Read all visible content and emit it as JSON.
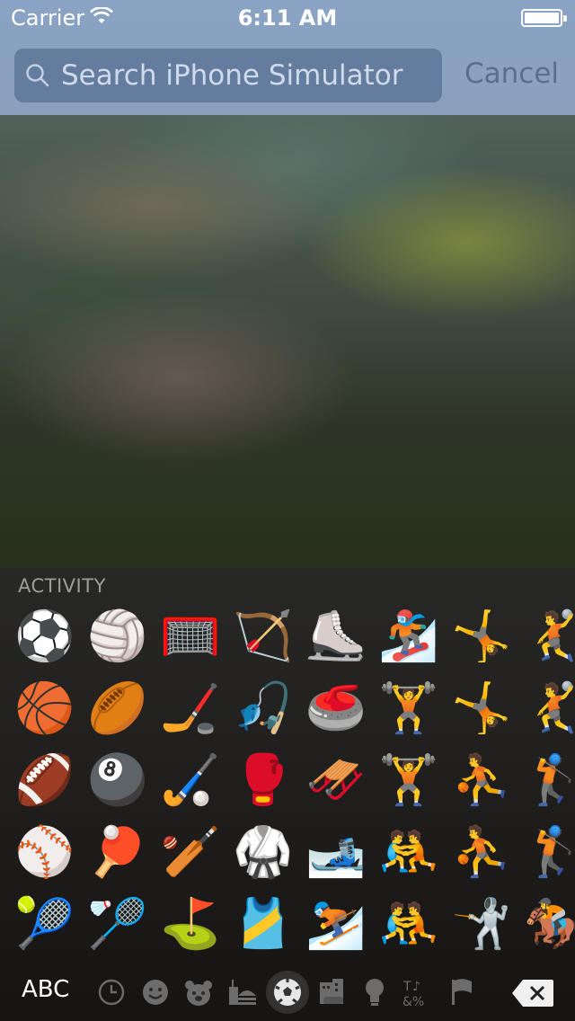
{
  "status": {
    "carrier": "Carrier",
    "time": "6:11 AM"
  },
  "search": {
    "placeholder": "Search iPhone Simulator",
    "cancel": "Cancel"
  },
  "keyboard": {
    "section": "ACTIVITY",
    "abc": "ABC",
    "emoji": [
      [
        "⚽",
        "🏐",
        "🥅",
        "🏹",
        "⛸️",
        "🏂",
        "🤸",
        "🤾"
      ],
      [
        "🏀",
        "🏉",
        "🏒",
        "🎣",
        "🥌",
        "🏋️",
        "🤸",
        "🤾"
      ],
      [
        "🏈",
        "🎱",
        "🏑",
        "🥊",
        "🛷",
        "🏋️",
        "⛹️",
        "🏌️"
      ],
      [
        "⚾",
        "🏓",
        "🏏",
        "🥋",
        "🎿",
        "🤼",
        "⛹️",
        "🏌️"
      ],
      [
        "🎾",
        "🏸",
        "⛳",
        "🎽",
        "⛷️",
        "🤼",
        "🤺",
        "🏇"
      ]
    ],
    "categories": [
      "recent-icon",
      "smiley-icon",
      "animal-icon",
      "food-icon",
      "activity-icon",
      "travel-icon",
      "objects-icon",
      "symbols-icon",
      "flags-icon"
    ],
    "selected_category": "activity-icon"
  }
}
